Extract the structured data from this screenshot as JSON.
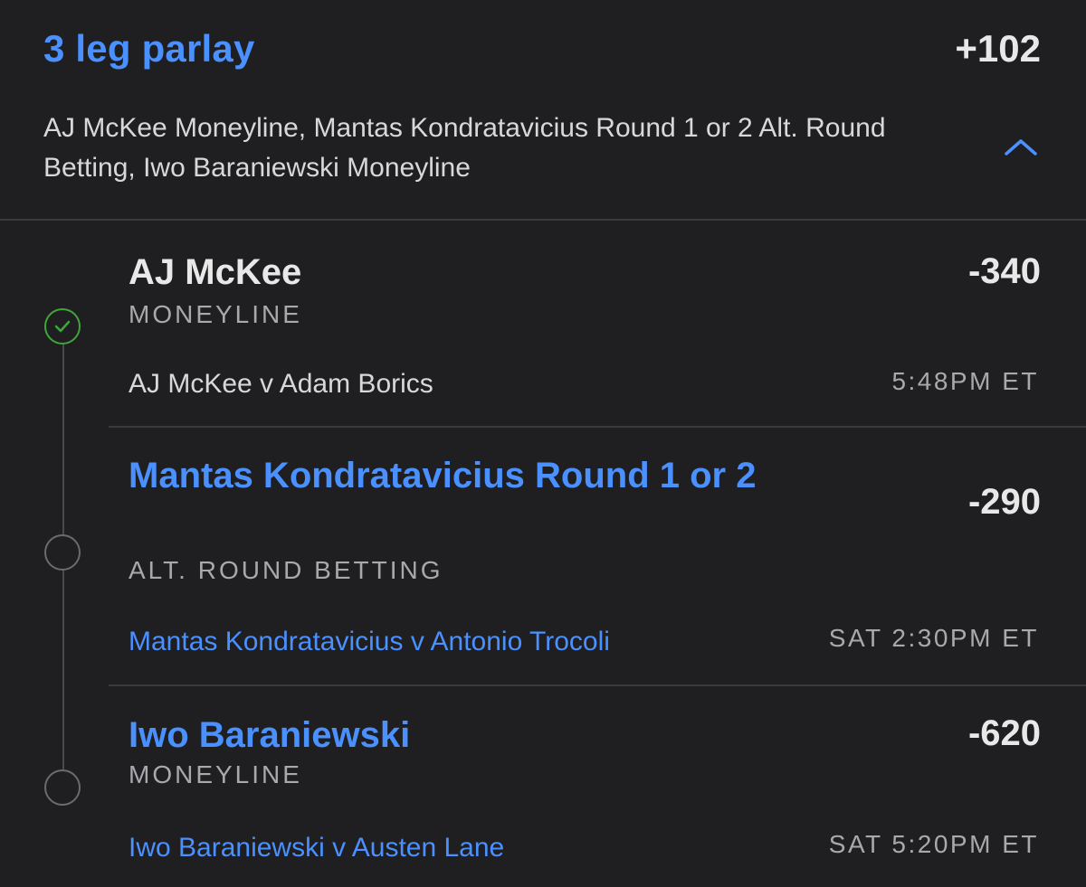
{
  "parlay": {
    "title": "3 leg parlay",
    "odds": "+102",
    "summary": "AJ McKee Moneyline, Mantas Kondratavicius Round 1 or 2 Alt. Round Betting, Iwo Baraniewski Moneyline",
    "collapse_icon": "chevron-up-icon",
    "accent_color": "#4a90ff"
  },
  "legs": [
    {
      "status": "won",
      "status_icon": "check-circle-icon",
      "selection": "AJ McKee",
      "market": "MONEYLINE",
      "odds": "-340",
      "event": "AJ McKee v Adam Borics",
      "time": "5:48PM ET"
    },
    {
      "status": "open",
      "status_icon": "empty-circle-icon",
      "selection": "Mantas Kondratavicius Round 1 or 2",
      "market": "ALT. ROUND BETTING",
      "odds": "-290",
      "event": "Mantas Kondratavicius v Antonio Trocoli",
      "time": "SAT 2:30PM ET"
    },
    {
      "status": "open",
      "status_icon": "empty-circle-icon",
      "selection": "Iwo Baraniewski",
      "market": "MONEYLINE",
      "odds": "-620",
      "event": "Iwo Baraniewski v Austen Lane",
      "time": "SAT 5:20PM ET"
    }
  ]
}
